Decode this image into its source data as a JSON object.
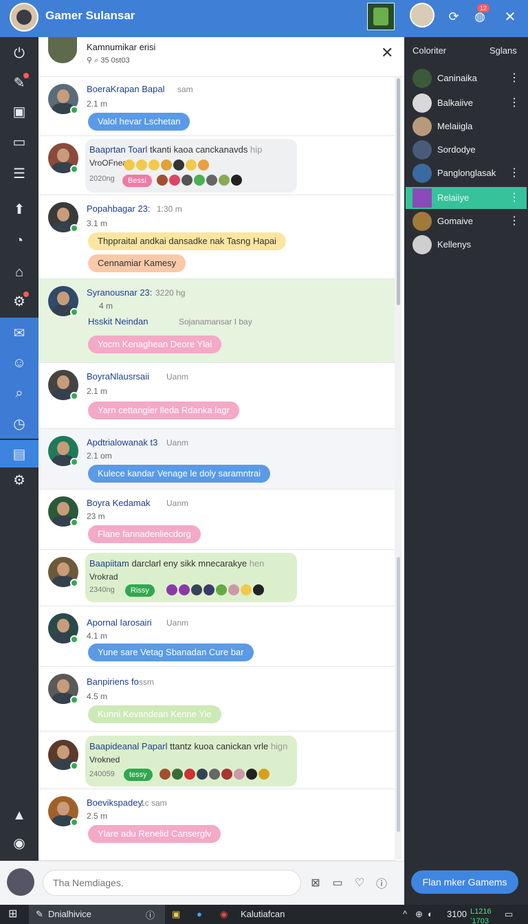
{
  "app": {
    "title": "Gamer Sulansar",
    "notif_count": "12"
  },
  "rail": [
    {
      "icon": "power-icon",
      "glyph": "⏻"
    },
    {
      "icon": "profile-icon",
      "glyph": "✎"
    },
    {
      "icon": "inbox-icon",
      "glyph": "▣"
    },
    {
      "icon": "monitor-icon",
      "glyph": "▭"
    },
    {
      "icon": "list-icon",
      "glyph": "☰"
    },
    {
      "icon": "upload-icon",
      "glyph": "⬆"
    },
    {
      "icon": "clock-icon",
      "glyph": "◔"
    },
    {
      "icon": "home-icon",
      "glyph": "⌂"
    },
    {
      "icon": "settings-icon",
      "glyph": "⚙"
    },
    {
      "icon": "mail-icon",
      "glyph": "✉"
    },
    {
      "icon": "bot-icon",
      "glyph": "☺"
    },
    {
      "icon": "search-icon",
      "glyph": "⌕"
    },
    {
      "icon": "history-icon",
      "glyph": "◷"
    },
    {
      "icon": "folder-icon",
      "glyph": "▤"
    },
    {
      "icon": "gear-icon",
      "glyph": "⚙"
    },
    {
      "icon": "upload-small-icon",
      "glyph": "▲"
    },
    {
      "icon": "location-icon",
      "glyph": "◉"
    }
  ],
  "chat_header": {
    "name": "Kamnumikar erisi",
    "sub": "35 0st03"
  },
  "messages": [
    {
      "name": "BoeraKrapan Bapal",
      "time": "sam",
      "sub": "2.1 m",
      "pill": "Valol hevar Lschetan",
      "pill_color": "blue"
    },
    {
      "name": "Baaprtan",
      "name_b": "Toarl",
      "text": "tkanti kaoa canckanavds",
      "time": "hip",
      "sub": "VroOFnea",
      "sub2": "2020ng",
      "tag": "Bessi"
    },
    {
      "name": "Popahbagar 23:",
      "time": "1:30 m",
      "sub": "3.1 m",
      "pill": "Thppraital andkai dansadke nak Tasng Hapai",
      "pill_color": "yellow",
      "pill2": "Cennamiar Kamesy",
      "pill2_color": "peach"
    },
    {
      "name": "Syranousnar 23:",
      "time": "3220 hg",
      "sub": "4 m",
      "line": "Hsskit Neindan",
      "line_b": "Sojanamansar I bay",
      "pill": "Yocm Kenaghean Deore Ylai",
      "pill_color": "pink"
    },
    {
      "name": "BoyraNlausrsaii",
      "time": "Uanm",
      "sub": "2.1 m",
      "pill": "Yarn cettangier lleda Rdanka lagr",
      "pill_color": "pink"
    },
    {
      "name": "Apdtrialowanak",
      "name_b": "t3",
      "time": "Uanm",
      "sub": "2.1 om",
      "pill": "Kulece kandar Venage le doly saramntrai",
      "pill_color": "blue"
    },
    {
      "name": "Boyra Kedamak",
      "time": "Uanm",
      "sub": "23 m",
      "pill": "Flane fannadenliecdorg",
      "pill_color": "pink"
    },
    {
      "name": "Baapiitam",
      "text": "darclarl eny sikk mnecarakye",
      "time": "hen",
      "sub": "Vrokrad",
      "sub2": "2340ng",
      "tag": "Rissy"
    },
    {
      "name": "Apornal Iarosairi",
      "time": "Uanm",
      "sub": "4.1 m",
      "pill": "Yune sare Vetag Sbanadan Cure bar",
      "pill_color": "blue"
    },
    {
      "name": "Banpiriens fo",
      "time": "ssm",
      "sub": "4.5 m",
      "pill": "Kunni Kevandean Kenne Yie",
      "pill_color": "green"
    },
    {
      "name": "Baapideanal Paparl",
      "text": "ttantz kuoa canickan vrle",
      "time": "hign",
      "sub": "Vrokned",
      "sub2": "240059",
      "tag": "tessy"
    },
    {
      "name": "Boevikspadey",
      "time": "1c sam",
      "sub": "2.5 m",
      "pill": "Ylare adu Renelid Canserglv",
      "pill_color": "pink"
    }
  ],
  "right_panel": {
    "tab1": "Coloriter",
    "tab2": "Sglans",
    "items": [
      {
        "label": "Caninaika",
        "more": true
      },
      {
        "label": "Balkaiive",
        "more": true
      },
      {
        "label": "Melaiigla",
        "more": false
      },
      {
        "label": "Sordodye",
        "more": false
      },
      {
        "label": "Panglonglasak",
        "more": true
      },
      {
        "label": "Relaiiye",
        "more": true,
        "active": true
      },
      {
        "label": "Gomaive",
        "more": true
      },
      {
        "label": "Kellenys",
        "more": false
      }
    ],
    "cta": "Flan mker Gamems"
  },
  "composer": {
    "placeholder": "Tha Nemdiages."
  },
  "taskbar": {
    "search": "Dnialhivice",
    "browser": "Kalutiafcan",
    "time": "3100",
    "clock_a": "L1216",
    "clock_b": "‵1703"
  },
  "colors": {
    "accent": "#3f7fd6",
    "rail": "#2d3138",
    "panel": "#2b2f35",
    "active": "#36c39a"
  }
}
